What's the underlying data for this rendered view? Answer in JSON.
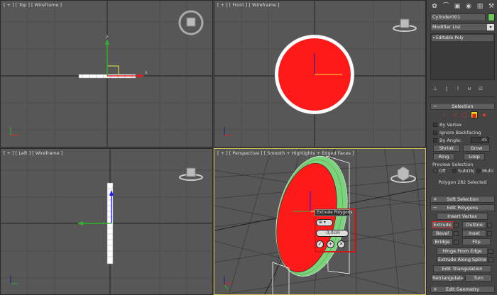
{
  "viewports": {
    "top": {
      "label": "[ + ] [ Top ] [ Wireframe ]"
    },
    "front": {
      "label": "[ + ] [ Front ] [ Wireframe ]"
    },
    "left": {
      "label": "[ + ] [ Left ] [ Wireframe ]"
    },
    "perspective": {
      "label": "[ + ] [ Perspective ] [ Smooth + Highlights + Edged Faces ]"
    }
  },
  "command_panel": {
    "tabs": [
      "✿",
      "⌒",
      "▣",
      "◉",
      "▥",
      "⚒"
    ],
    "object_name": "Cylinder001",
    "object_color": "#6bc85a",
    "modifier_list": "Modifier List",
    "stack_item": "Editable Poly",
    "stack_tools": [
      "⊥",
      "|",
      "⌇",
      "⊌",
      "⊡"
    ]
  },
  "selection": {
    "title": "Selection",
    "by_vertex": "By Vertex",
    "ignore_backfacing": "Ignore Backfacing",
    "by_angle": "By Angle:",
    "angle_value": "45",
    "shrink": "Shrink",
    "grow": "Grow",
    "ring": "Ring",
    "loop": "Loop",
    "preview_selection": "Preview Selection",
    "preview_off": "Off",
    "preview_subobj": "SubObj",
    "preview_multi": "Multi",
    "status": "Polygon 282 Selected"
  },
  "soft_selection": {
    "title": "Soft Selection"
  },
  "edit_polygons": {
    "title": "Edit Polygons",
    "insert_vertex": "Insert Vertex",
    "extrude": "Extrude",
    "outline": "Outline",
    "bevel": "Bevel",
    "inset": "Inset",
    "bridge": "Bridge",
    "flip": "Flip",
    "hinge_from_edge": "Hinge From Edge",
    "extrude_along_spline": "Extrude Along Spline",
    "edit_triangulation": "Edit Triangulation",
    "retriangulate": "Retriangulate",
    "turn": "Turn"
  },
  "edit_geometry": {
    "title": "Edit Geometry"
  },
  "extrude_caddy": {
    "title": "Extrude Polygons",
    "type_icon": "⊞ ▾",
    "height": "-3,0cm",
    "ok": "✓",
    "apply": "+",
    "cancel": "✕"
  },
  "colors": {
    "accent_red": "#ff1a1a",
    "highlight_red": "#d01818",
    "active_viewport": "#d8c35a"
  }
}
